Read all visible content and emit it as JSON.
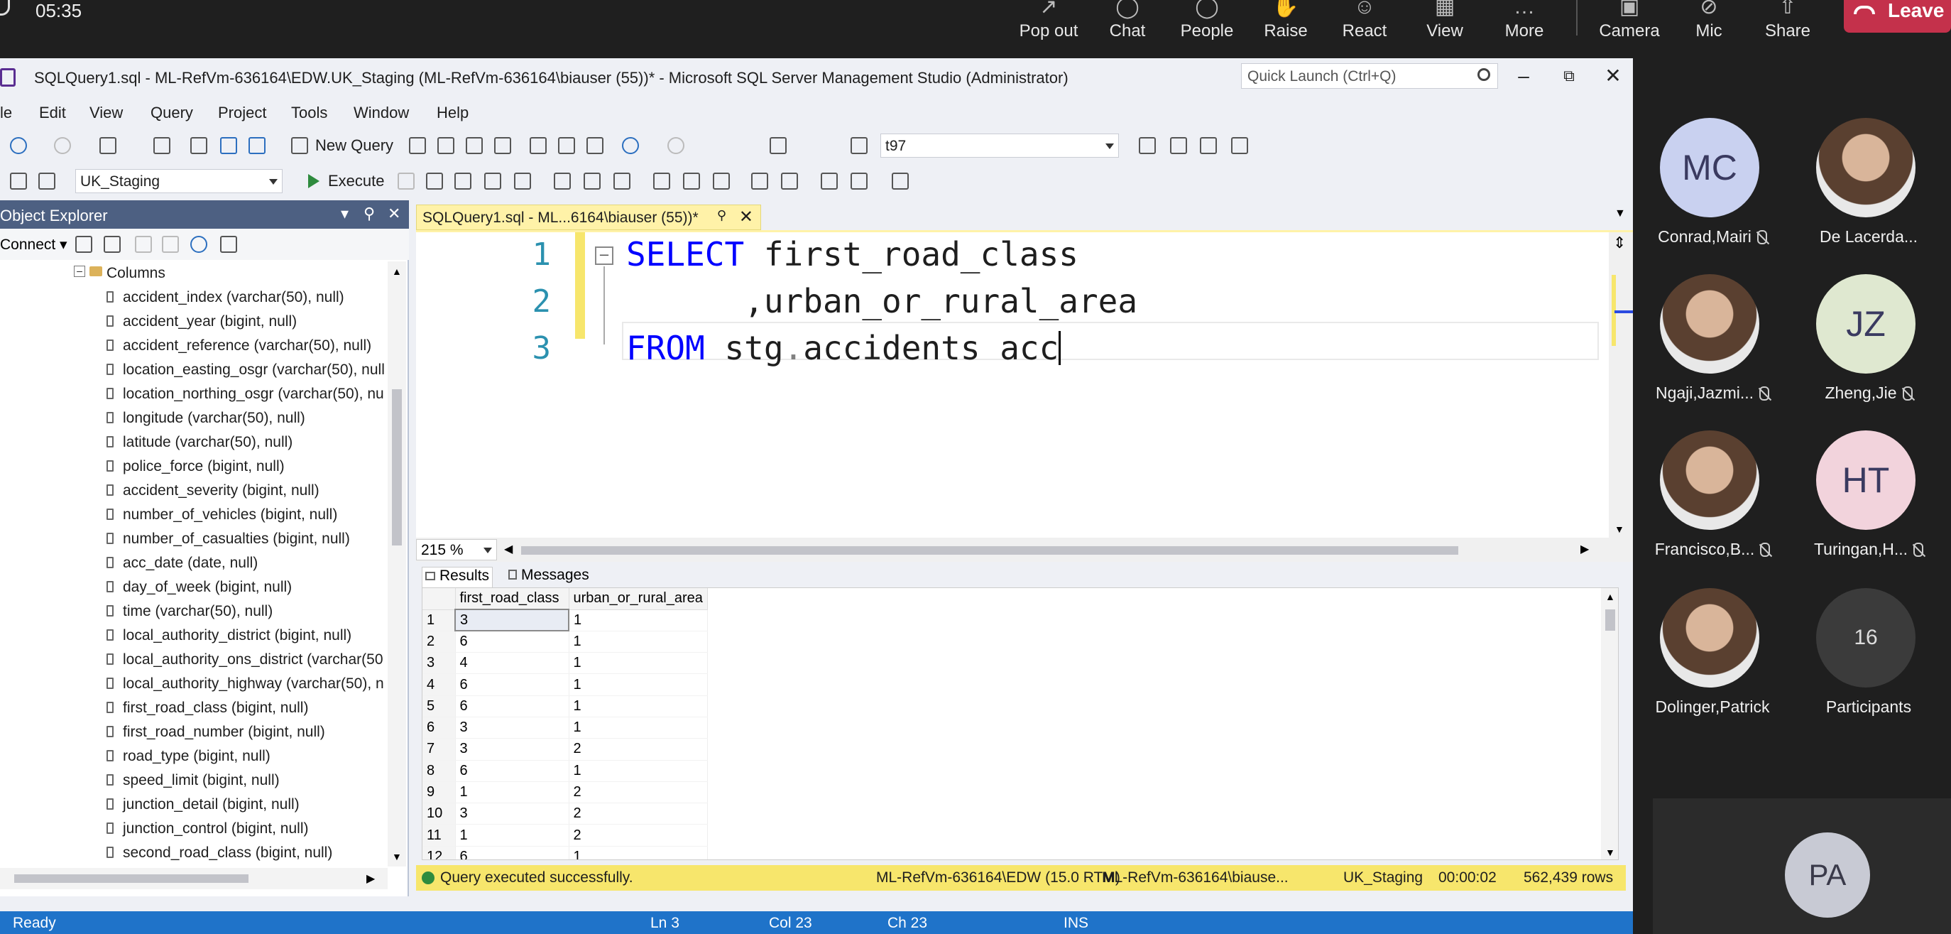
{
  "teams": {
    "clock": "05:35",
    "buttons": [
      {
        "label": "Pop out"
      },
      {
        "label": "Chat"
      },
      {
        "label": "People"
      },
      {
        "label": "Raise"
      },
      {
        "label": "React"
      },
      {
        "label": "View"
      },
      {
        "label": "More"
      },
      {
        "label": "Camera"
      },
      {
        "label": "Mic"
      },
      {
        "label": "Share"
      }
    ],
    "leave_label": "Leave",
    "participants": [
      {
        "initials": "MC",
        "name": "Conrad,Mairi",
        "muted": true,
        "avatar_color": "#c9d1f0"
      },
      {
        "initials": "",
        "name": "De Lacerda...",
        "muted": false,
        "avatar_color": "#dcdcdc"
      },
      {
        "initials": "",
        "name": "Ngaji,Jazmi...",
        "muted": true,
        "avatar_color": "#8a6aa8"
      },
      {
        "initials": "JZ",
        "name": "Zheng,Jie",
        "muted": true,
        "avatar_color": "#dfe8d0"
      },
      {
        "initials": "",
        "name": "Francisco,B...",
        "muted": true,
        "avatar_color": "#cfcfcf"
      },
      {
        "initials": "HT",
        "name": "Turingan,H...",
        "muted": true,
        "avatar_color": "#f2d3dc"
      },
      {
        "initials": "",
        "name": "Dolinger,Patrick",
        "muted": false,
        "avatar_color": "#e0b090"
      },
      {
        "initials": "16",
        "name": "Participants",
        "muted": false,
        "avatar_color": "#3b3b3b"
      }
    ],
    "presenter_initials": "PA"
  },
  "ssms": {
    "title": "SQLQuery1.sql - ML-RefVm-636164\\EDW.UK_Staging (ML-RefVm-636164\\biauser (55))* - Microsoft SQL Server Management Studio (Administrator)",
    "quick_launch_placeholder": "Quick Launch (Ctrl+Q)",
    "menu": [
      "le",
      "Edit",
      "View",
      "Query",
      "Project",
      "Tools",
      "Window",
      "Help"
    ],
    "toolbar": {
      "new_query": "New Query",
      "server_combo": "t97",
      "database_combo": "UK_Staging",
      "execute": "Execute"
    },
    "object_explorer": {
      "title": "Object Explorer",
      "connect": "Connect",
      "columns_folder": "Columns",
      "columns": [
        "accident_index (varchar(50), null)",
        "accident_year (bigint, null)",
        "accident_reference (varchar(50), null)",
        "location_easting_osgr (varchar(50), null",
        "location_northing_osgr (varchar(50), nu",
        "longitude (varchar(50), null)",
        "latitude (varchar(50), null)",
        "police_force (bigint, null)",
        "accident_severity (bigint, null)",
        "number_of_vehicles (bigint, null)",
        "number_of_casualties (bigint, null)",
        "acc_date (date, null)",
        "day_of_week (bigint, null)",
        "time (varchar(50), null)",
        "local_authority_district (bigint, null)",
        "local_authority_ons_district (varchar(50",
        "local_authority_highway (varchar(50), n",
        "first_road_class (bigint, null)",
        "first_road_number (bigint, null)",
        "road_type (bigint, null)",
        "speed_limit (bigint, null)",
        "junction_detail (bigint, null)",
        "junction_control (bigint, null)",
        "second_road_class (bigint, null)"
      ]
    },
    "editor": {
      "tab_title": "SQLQuery1.sql - ML...6164\\biauser (55))*",
      "lines": [
        {
          "no": "1",
          "kw": "SELECT",
          "rest": " first_road_class",
          "dot": ""
        },
        {
          "no": "2",
          "kw": "",
          "rest": "      ,urban_or_rural_area",
          "dot": ""
        },
        {
          "no": "3",
          "kw": "FROM",
          "rest": " stg",
          "dot": ".",
          "tail": "accidents acc"
        }
      ],
      "zoom": "215 %"
    },
    "results": {
      "tabs": [
        "Results",
        "Messages"
      ],
      "columns": [
        "first_road_class",
        "urban_or_rural_area"
      ],
      "rows": [
        [
          "1",
          "3",
          "1"
        ],
        [
          "2",
          "6",
          "1"
        ],
        [
          "3",
          "4",
          "1"
        ],
        [
          "4",
          "6",
          "1"
        ],
        [
          "5",
          "6",
          "1"
        ],
        [
          "6",
          "3",
          "1"
        ],
        [
          "7",
          "3",
          "2"
        ],
        [
          "8",
          "6",
          "1"
        ],
        [
          "9",
          "1",
          "2"
        ],
        [
          "10",
          "3",
          "2"
        ],
        [
          "11",
          "1",
          "2"
        ],
        [
          "12",
          "6",
          "1"
        ]
      ]
    },
    "query_status": {
      "message": "Query executed successfully.",
      "server": "ML-RefVm-636164\\EDW (15.0 RTM)",
      "user": "ML-RefVm-636164\\biause...",
      "database": "UK_Staging",
      "elapsed": "00:00:02",
      "rows": "562,439 rows"
    },
    "statusbar": {
      "state": "Ready",
      "ln": "Ln 3",
      "col": "Col 23",
      "ch": "Ch 23",
      "mode": "INS"
    }
  }
}
